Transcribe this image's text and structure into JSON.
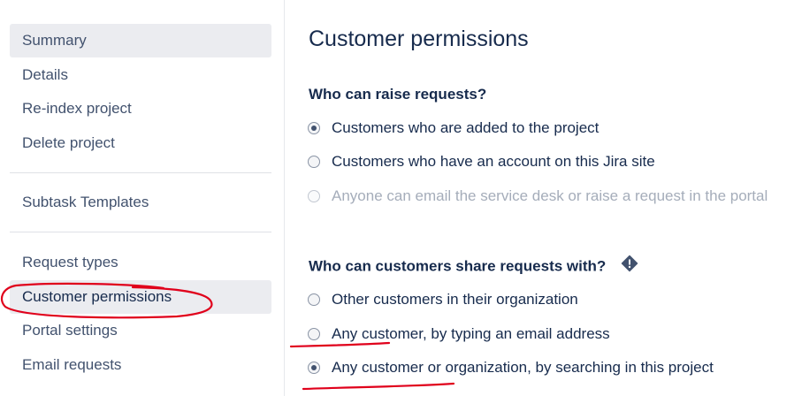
{
  "sidebar": {
    "items": [
      {
        "label": "Summary"
      },
      {
        "label": "Details"
      },
      {
        "label": "Re-index project"
      },
      {
        "label": "Delete project"
      },
      {
        "label": "Subtask Templates"
      },
      {
        "label": "Request types"
      },
      {
        "label": "Customer permissions"
      },
      {
        "label": "Portal settings"
      },
      {
        "label": "Email requests"
      }
    ]
  },
  "main": {
    "title": "Customer permissions",
    "raise_section": {
      "heading": "Who can raise requests?",
      "options": [
        {
          "label": "Customers who are added to the project",
          "checked": true
        },
        {
          "label": "Customers who have an account on this Jira site",
          "checked": false
        },
        {
          "label": "Anyone can email the service desk or raise a request in the portal",
          "checked": false,
          "disabled": true
        }
      ]
    },
    "share_section": {
      "heading": "Who can customers share requests with?",
      "icon": "warning-icon",
      "options": [
        {
          "label": "Other customers in their organization",
          "checked": false
        },
        {
          "label": "Any customer, by typing an email address",
          "checked": false
        },
        {
          "label": "Any customer or organization, by searching in this project",
          "checked": true
        }
      ]
    }
  },
  "colors": {
    "annotation": "#e0001b",
    "selected_bg": "#ebecf0",
    "text_primary": "#172b4d",
    "text_secondary": "#42526e",
    "text_disabled": "#a5adba"
  }
}
